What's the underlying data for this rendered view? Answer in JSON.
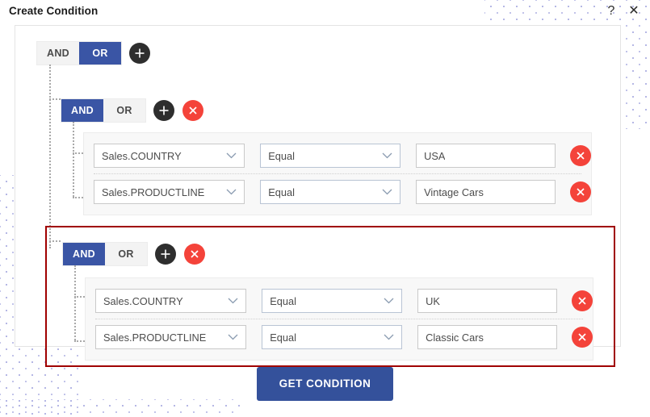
{
  "window": {
    "title": "Create Condition",
    "help_icon": "question-mark-icon",
    "help_glyph": "?",
    "close_icon": "close-icon",
    "close_glyph": "✕"
  },
  "colors": {
    "accent_blue": "#3a55a5",
    "primary_button": "#34519b",
    "delete_red": "#f4433a",
    "add_black": "#2e2e2e",
    "highlight_border": "#a00000",
    "row_background": "#f8f8f8",
    "toggle_inactive": "#f3f3f3",
    "dot_pattern": "#8b8fd6"
  },
  "root_group": {
    "operator_options": [
      "AND",
      "OR"
    ],
    "selected_operator": "OR",
    "add_icon": "plus-icon",
    "add_glyph": "+"
  },
  "groups": [
    {
      "operator_options": [
        "AND",
        "OR"
      ],
      "selected_operator": "AND",
      "add_icon": "plus-icon",
      "delete_icon": "close-circle-icon",
      "highlighted": false,
      "rows": [
        {
          "field": "Sales.COUNTRY",
          "operator": "Equal",
          "value": "USA",
          "value_placeholder": "",
          "chevron_icon": "chevron-down-icon",
          "delete_icon": "close-circle-icon"
        },
        {
          "field": "Sales.PRODUCTLINE",
          "operator": "Equal",
          "value": "Vintage Cars",
          "value_placeholder": "",
          "chevron_icon": "chevron-down-icon",
          "delete_icon": "close-circle-icon"
        }
      ]
    },
    {
      "operator_options": [
        "AND",
        "OR"
      ],
      "selected_operator": "AND",
      "add_icon": "plus-icon",
      "delete_icon": "close-circle-icon",
      "highlighted": true,
      "rows": [
        {
          "field": "Sales.COUNTRY",
          "operator": "Equal",
          "value": "UK",
          "value_placeholder": "",
          "chevron_icon": "chevron-down-icon",
          "delete_icon": "close-circle-icon"
        },
        {
          "field": "Sales.PRODUCTLINE",
          "operator": "Equal",
          "value": "Classic Cars",
          "value_placeholder": "",
          "chevron_icon": "chevron-down-icon",
          "delete_icon": "close-circle-icon"
        }
      ]
    }
  ],
  "footer": {
    "submit_label": "GET CONDITION"
  }
}
